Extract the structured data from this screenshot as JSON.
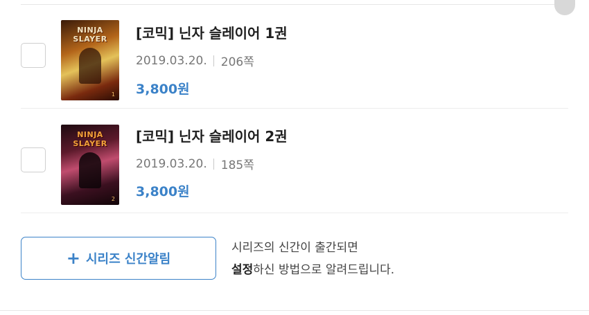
{
  "books": [
    {
      "title": "[코믹] 닌자 슬레이어 1권",
      "date": "2019.03.20.",
      "pages": "206쪽",
      "price": "3,800원",
      "cover_text": "NINJA SLAYER",
      "cover_number": "1"
    },
    {
      "title": "[코믹] 닌자 슬레이어 2권",
      "date": "2019.03.20.",
      "pages": "185쪽",
      "price": "3,800원",
      "cover_text": "NINJA SLAYER",
      "cover_number": "2"
    }
  ],
  "series_alert": {
    "button_label": "시리즈 신간알림",
    "notice_line1": "시리즈의 신간이 출간되면",
    "notice_bold": "설정",
    "notice_rest": "하신 방법으로 알려드립니다."
  },
  "colors": {
    "accent": "#3b82c8",
    "title": "#1f1f1f",
    "meta": "#777777"
  }
}
